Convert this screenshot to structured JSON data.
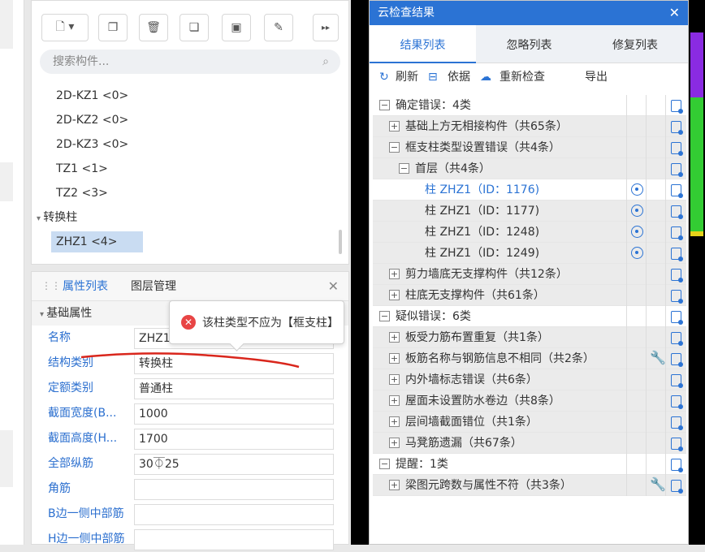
{
  "left_panel": {
    "search_placeholder": "搜索构件...",
    "tree_items": [
      "2D-KZ1 <0>",
      "2D-KZ2 <0>",
      "2D-KZ3 <0>",
      "TZ1 <1>",
      "TZ2 <3>"
    ],
    "group_label": "转换柱",
    "selected_item": "ZHZ1 <4>"
  },
  "properties": {
    "tabs": [
      "属性列表",
      "图层管理"
    ],
    "section": "基础属性",
    "rows": [
      {
        "label": "名称",
        "value": "ZHZ1"
      },
      {
        "label": "结构类别",
        "value": "转换柱"
      },
      {
        "label": "定额类别",
        "value": "普通柱"
      },
      {
        "label": "截面宽度(B...",
        "value": "1000"
      },
      {
        "label": "截面高度(H...",
        "value": "1700"
      },
      {
        "label": "全部纵筋",
        "value": "30⏁25"
      },
      {
        "label": "角筋",
        "value": ""
      },
      {
        "label": "B边一侧中部筋",
        "value": ""
      },
      {
        "label": "H边一侧中部筋",
        "value": ""
      }
    ]
  },
  "tooltip": {
    "text": "该柱类型不应为【框支柱】"
  },
  "dialog": {
    "title": "云检查结果",
    "tabs": [
      "结果列表",
      "忽略列表",
      "修复列表"
    ],
    "toolbar": {
      "refresh": "刷新",
      "basis": "依据",
      "recheck": "重新检查",
      "export": "导出"
    },
    "rows": [
      {
        "text": "确定错误：4类",
        "level": 0,
        "toggle": "−"
      },
      {
        "text": "基础上方无相接构件（共65条）",
        "level": 1,
        "toggle": "+"
      },
      {
        "text": "框支柱类型设置错误（共4条）",
        "level": 1,
        "toggle": "−"
      },
      {
        "text": "首层（共4条）",
        "level": 2,
        "toggle": "−"
      },
      {
        "text": "柱 ZHZ1（ID：1176)",
        "level": 3,
        "toggle": "",
        "locate": true,
        "link": true
      },
      {
        "text": "柱 ZHZ1（ID：1177)",
        "level": 3,
        "toggle": "",
        "locate": true
      },
      {
        "text": "柱 ZHZ1（ID：1248)",
        "level": 3,
        "toggle": "",
        "locate": true
      },
      {
        "text": "柱 ZHZ1（ID：1249)",
        "level": 3,
        "toggle": "",
        "locate": true
      },
      {
        "text": "剪力墙底无支撑构件（共12条）",
        "level": 1,
        "toggle": "+"
      },
      {
        "text": "柱底无支撑构件（共61条）",
        "level": 1,
        "toggle": "+"
      },
      {
        "text": "疑似错误：6类",
        "level": 0,
        "toggle": "−"
      },
      {
        "text": "板受力筋布置重复（共1条）",
        "level": 1,
        "toggle": "+"
      },
      {
        "text": "板筋名称与钢筋信息不相同（共2条）",
        "level": 1,
        "toggle": "+",
        "fix": true
      },
      {
        "text": "内外墙标志错误（共6条）",
        "level": 1,
        "toggle": "+"
      },
      {
        "text": "屋面未设置防水卷边（共8条）",
        "level": 1,
        "toggle": "+"
      },
      {
        "text": "层间墙截面错位（共1条）",
        "level": 1,
        "toggle": "+"
      },
      {
        "text": "马凳筋遗漏（共67条）",
        "level": 1,
        "toggle": "+"
      },
      {
        "text": "提醒：1类",
        "level": 0,
        "toggle": "−"
      },
      {
        "text": "梁图元跨数与属性不符（共3条）",
        "level": 1,
        "toggle": "+",
        "fix": true
      }
    ]
  },
  "colors": {
    "accent": "#2b73d4",
    "error": "#e84545"
  }
}
